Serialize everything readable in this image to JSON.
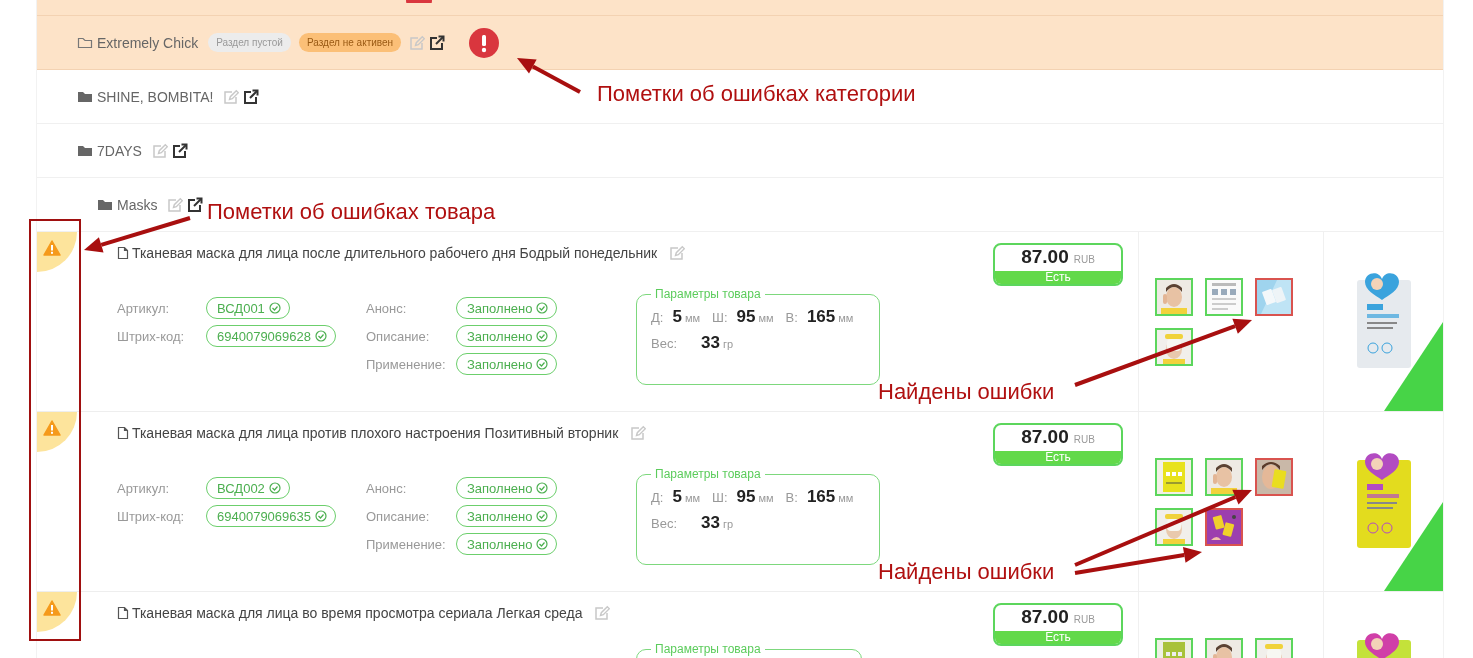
{
  "top_row": {
    "error": true
  },
  "categories": [
    {
      "name": "Extremely Chick",
      "empty": true,
      "highlighted": true,
      "error": true,
      "badges": [
        {
          "label": "Раздел пустой",
          "kind": "empty"
        },
        {
          "label": "Раздел не активен",
          "kind": "inactive"
        }
      ]
    },
    {
      "name": "SHINE, BOMBITA!",
      "empty": false,
      "highlighted": false,
      "error": false
    },
    {
      "name": "7DAYS",
      "empty": false,
      "highlighted": false,
      "error": false,
      "children": [
        {
          "name": "Masks",
          "empty": false,
          "highlighted": false,
          "error": false,
          "products": [
            {
              "title": "Тканевая маска для лица после длительного рабочего дня Бодрый понедельник",
              "warning": true,
              "price": "87.00",
              "currency": "RUB",
              "stock": "Есть",
              "field_groups": [
                {
                  "fields": [
                    {
                      "label": "Артикул:",
                      "value": "ВСД001",
                      "ok": true
                    },
                    {
                      "label": "Штрих-код:",
                      "value": "6940079069628",
                      "ok": true
                    }
                  ]
                },
                {
                  "fields": [
                    {
                      "label": "Анонс:",
                      "value": "Заполнено",
                      "ok": true
                    },
                    {
                      "label": "Описание:",
                      "value": "Заполнено",
                      "ok": true
                    },
                    {
                      "label": "Применение:",
                      "value": "Заполнено",
                      "ok": true
                    }
                  ]
                }
              ],
              "params": {
                "legend": "Параметры товара",
                "dims": [
                  {
                    "label": "Д:",
                    "value": "5",
                    "unit": "мм"
                  },
                  {
                    "label": "Ш:",
                    "value": "95",
                    "unit": "мм"
                  },
                  {
                    "label": "В:",
                    "value": "165",
                    "unit": "мм"
                  }
                ],
                "weight": {
                  "label": "Вес:",
                  "value": "33",
                  "unit": "гр"
                }
              },
              "images": [
                {
                  "error": false
                },
                {
                  "error": false
                },
                {
                  "error": true
                },
                {
                  "error": false
                }
              ],
              "photo_marked": true
            },
            {
              "title": "Тканевая маска для лица против плохого настроения Позитивный вторник",
              "warning": true,
              "price": "87.00",
              "currency": "RUB",
              "stock": "Есть",
              "field_groups": [
                {
                  "fields": [
                    {
                      "label": "Артикул:",
                      "value": "ВСД002",
                      "ok": true
                    },
                    {
                      "label": "Штрих-код:",
                      "value": "6940079069635",
                      "ok": true
                    }
                  ]
                },
                {
                  "fields": [
                    {
                      "label": "Анонс:",
                      "value": "Заполнено",
                      "ok": true
                    },
                    {
                      "label": "Описание:",
                      "value": "Заполнено",
                      "ok": true
                    },
                    {
                      "label": "Применение:",
                      "value": "Заполнено",
                      "ok": true
                    }
                  ]
                }
              ],
              "params": {
                "legend": "Параметры товара",
                "dims": [
                  {
                    "label": "Д:",
                    "value": "5",
                    "unit": "мм"
                  },
                  {
                    "label": "Ш:",
                    "value": "95",
                    "unit": "мм"
                  },
                  {
                    "label": "В:",
                    "value": "165",
                    "unit": "мм"
                  }
                ],
                "weight": {
                  "label": "Вес:",
                  "value": "33",
                  "unit": "гр"
                }
              },
              "images": [
                {
                  "error": false
                },
                {
                  "error": false
                },
                {
                  "error": true
                },
                {
                  "error": false
                },
                {
                  "error": true
                }
              ],
              "photo_marked": true
            },
            {
              "title": "Тканевая маска для лица во время просмотра сериала Легкая среда",
              "warning": true,
              "price": "87.00",
              "currency": "RUB",
              "stock": "Есть",
              "params": {
                "legend": "Параметры товара"
              },
              "images": [
                {
                  "error": false
                },
                {
                  "error": false
                },
                {
                  "error": false
                }
              ],
              "photo_marked": false
            }
          ]
        }
      ]
    }
  ],
  "annotations": [
    {
      "text": "Пометки об ошибках категории"
    },
    {
      "text": "Пометки об ошибках товара"
    },
    {
      "text": "Найдены ошибки"
    },
    {
      "text": "Найдены ошибки"
    }
  ]
}
